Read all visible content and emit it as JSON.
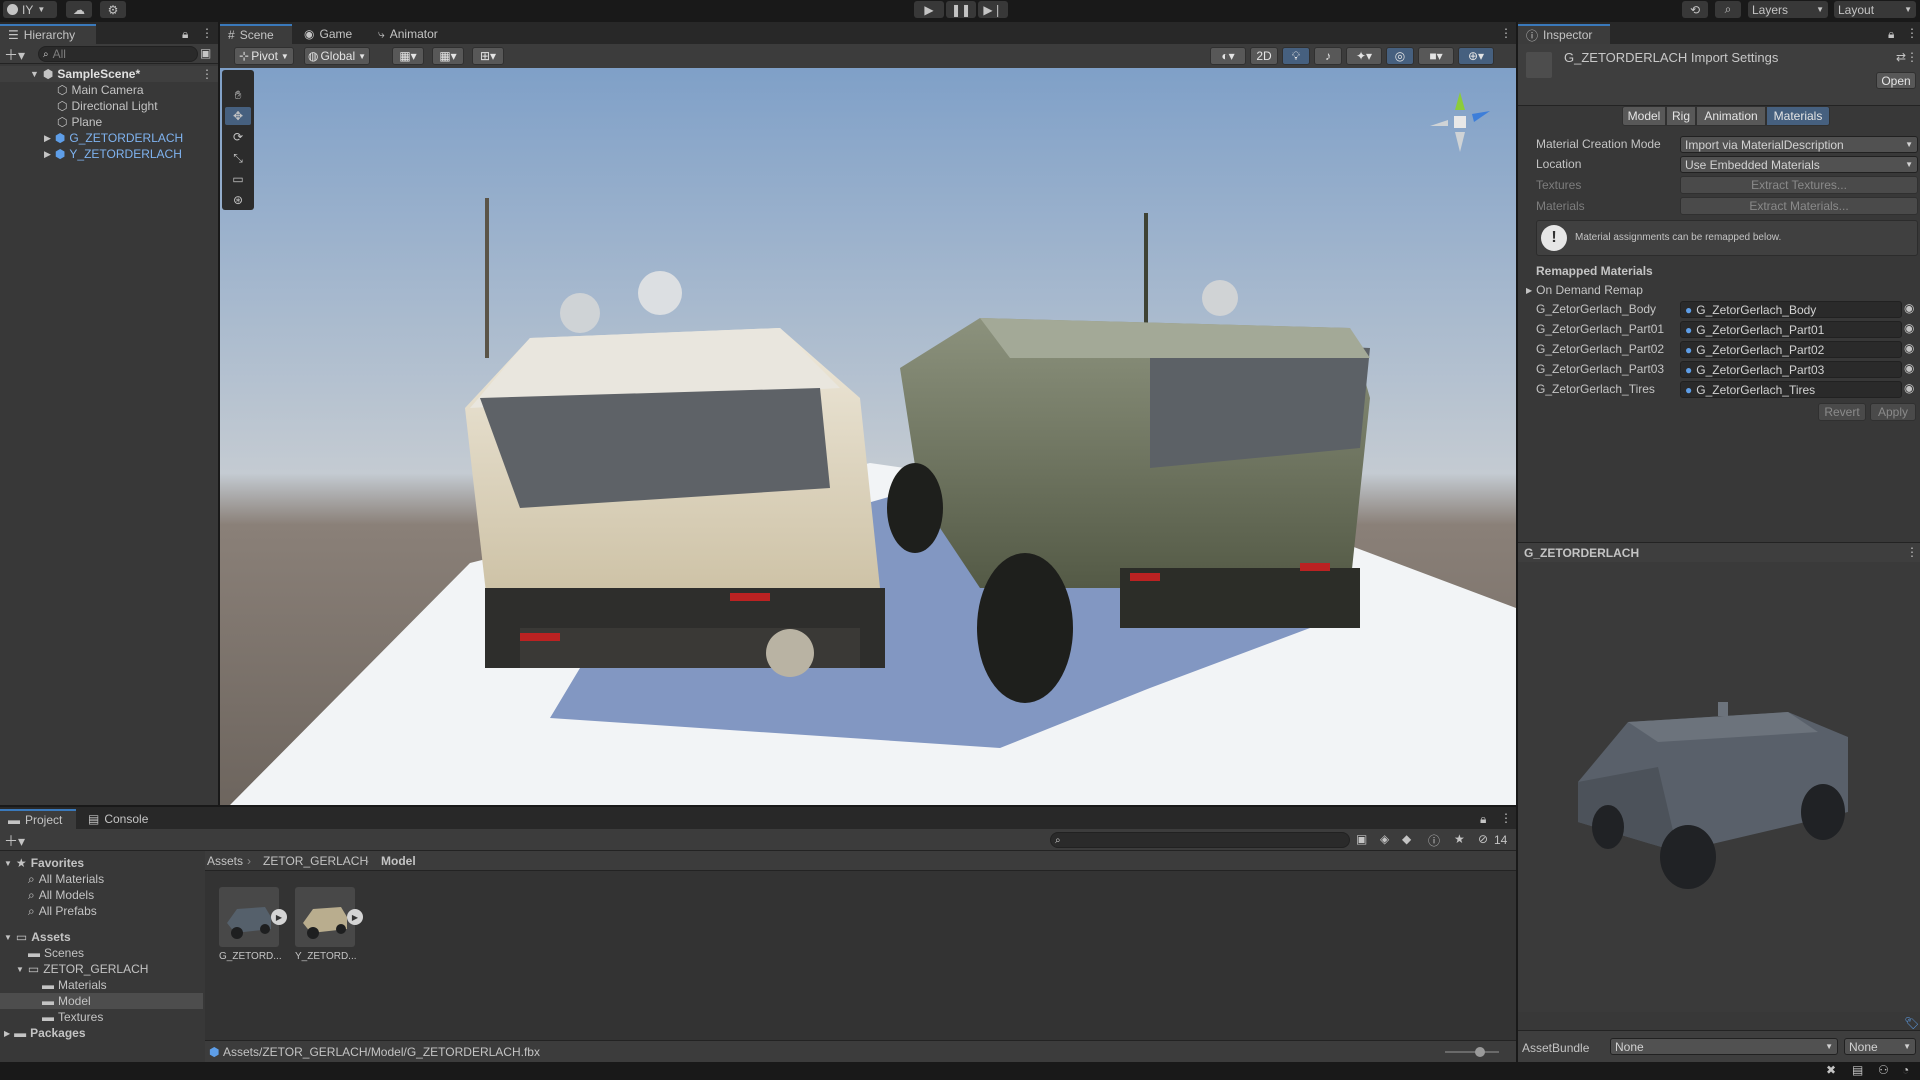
{
  "toolbar": {
    "account_label": "IY",
    "layers_label": "Layers",
    "layout_label": "Layout"
  },
  "hierarchy": {
    "tab_label": "Hierarchy",
    "search_placeholder": "All",
    "scene_name": "SampleScene*",
    "items": [
      {
        "label": "Main Camera",
        "type": "object"
      },
      {
        "label": "Directional Light",
        "type": "object"
      },
      {
        "label": "Plane",
        "type": "object"
      },
      {
        "label": "G_ZETORDERLACH",
        "type": "prefab"
      },
      {
        "label": "Y_ZETORDERLACH",
        "type": "prefab"
      }
    ]
  },
  "scene_view": {
    "tabs": [
      "Scene",
      "Game",
      "Animator"
    ],
    "pivot_label": "Pivot",
    "global_label": "Global",
    "mode_2d_label": "2D"
  },
  "inspector": {
    "tab_label": "Inspector",
    "title": "G_ZETORDERLACH Import Settings",
    "open_label": "Open",
    "sub_tabs": [
      "Model",
      "Rig",
      "Animation",
      "Materials"
    ],
    "active_sub_tab": "Materials",
    "material_creation_mode_label": "Material Creation Mode",
    "material_creation_mode_value": "Import via MaterialDescription",
    "location_label": "Location",
    "location_value": "Use Embedded Materials",
    "textures_label": "Textures",
    "extract_textures_label": "Extract Textures...",
    "materials_label": "Materials",
    "extract_materials_label": "Extract Materials...",
    "info_text": "Material assignments can be remapped below.",
    "remapped_header": "Remapped Materials",
    "on_demand_label": "On Demand Remap",
    "remaps": [
      {
        "name": "G_ZetorGerlach_Body",
        "value": "G_ZetorGerlach_Body"
      },
      {
        "name": "G_ZetorGerlach_Part01",
        "value": "G_ZetorGerlach_Part01"
      },
      {
        "name": "G_ZetorGerlach_Part02",
        "value": "G_ZetorGerlach_Part02"
      },
      {
        "name": "G_ZetorGerlach_Part03",
        "value": "G_ZetorGerlach_Part03"
      },
      {
        "name": "G_ZetorGerlach_Tires",
        "value": "G_ZetorGerlach_Tires"
      }
    ],
    "revert_label": "Revert",
    "apply_label": "Apply",
    "preview_title": "G_ZETORDERLACH",
    "assetbundle_label": "AssetBundle",
    "assetbundle_value": "None",
    "assetbundle_variant": "None"
  },
  "project": {
    "tabs": [
      "Project",
      "Console"
    ],
    "hidden_count": "14",
    "favorites_label": "Favorites",
    "favorites": [
      "All Materials",
      "All Models",
      "All Prefabs"
    ],
    "assets_label": "Assets",
    "tree": [
      {
        "label": "Scenes",
        "depth": 1
      },
      {
        "label": "ZETOR_GERLACH",
        "depth": 1
      },
      {
        "label": "Materials",
        "depth": 2
      },
      {
        "label": "Model",
        "depth": 2
      },
      {
        "label": "Textures",
        "depth": 2
      }
    ],
    "packages_label": "Packages",
    "breadcrumb": [
      "Assets",
      "ZETOR_GERLACH",
      "Model"
    ],
    "files": [
      "G_ZETORD...",
      "Y_ZETORD..."
    ],
    "status_path": "Assets/ZETOR_GERLACH/Model/G_ZETORDERLACH.fbx"
  }
}
